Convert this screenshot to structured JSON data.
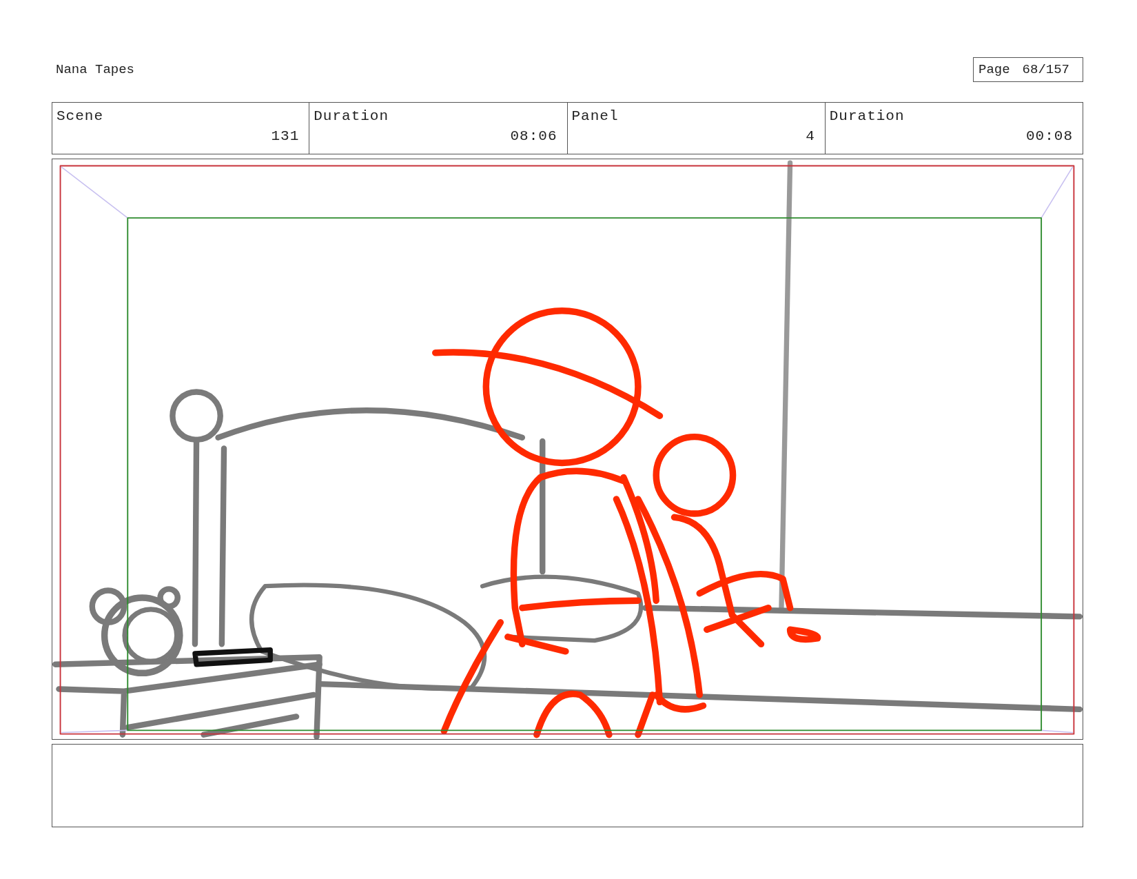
{
  "document": {
    "title": "Nana Tapes",
    "page_label": "Page",
    "page_number": "68/157"
  },
  "header": [
    {
      "label": "Scene",
      "value": "131"
    },
    {
      "label": "Duration",
      "value": "08:06"
    },
    {
      "label": "Panel",
      "value": "4"
    },
    {
      "label": "Duration",
      "value": "00:08"
    }
  ],
  "panel": {
    "kind": "sketch"
  }
}
